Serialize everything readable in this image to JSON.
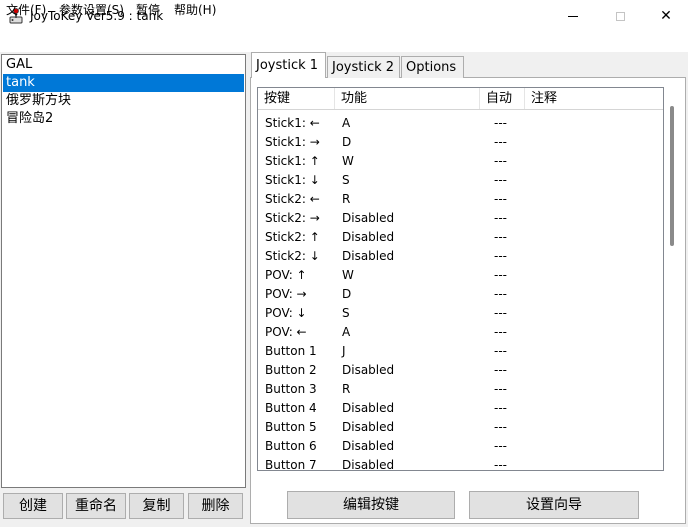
{
  "window": {
    "title": "JoyToKey Ver5.9 : tank",
    "close_glyph": "✕"
  },
  "menu": [
    {
      "label": "文件(F)"
    },
    {
      "label": "参数设置(S)"
    },
    {
      "label": "暂停"
    },
    {
      "label": "帮助(H)"
    }
  ],
  "profiles": [
    {
      "label": "GAL",
      "selected": false
    },
    {
      "label": "tank",
      "selected": true
    },
    {
      "label": "俄罗斯方块",
      "selected": false
    },
    {
      "label": "冒险岛2",
      "selected": false
    }
  ],
  "profile_buttons": {
    "create": "创建",
    "rename": "重命名",
    "copy": "复制",
    "delete": "删除"
  },
  "tabs": [
    {
      "label": "Joystick 1",
      "active": true
    },
    {
      "label": "Joystick 2",
      "active": false
    },
    {
      "label": "Options",
      "active": false
    }
  ],
  "table": {
    "headers": {
      "key": "按键",
      "function": "功能",
      "auto": "自动",
      "note": "注释"
    },
    "rows": [
      {
        "key": "Stick1: ←",
        "function": "A",
        "auto": "---"
      },
      {
        "key": "Stick1: →",
        "function": "D",
        "auto": "---"
      },
      {
        "key": "Stick1: ↑",
        "function": "W",
        "auto": "---"
      },
      {
        "key": "Stick1: ↓",
        "function": "S",
        "auto": "---"
      },
      {
        "key": "Stick2: ←",
        "function": "R",
        "auto": "---"
      },
      {
        "key": "Stick2: →",
        "function": "Disabled",
        "auto": "---"
      },
      {
        "key": "Stick2: ↑",
        "function": "Disabled",
        "auto": "---"
      },
      {
        "key": "Stick2: ↓",
        "function": "Disabled",
        "auto": "---"
      },
      {
        "key": "POV: ↑",
        "function": "W",
        "auto": "---"
      },
      {
        "key": "POV: →",
        "function": "D",
        "auto": "---"
      },
      {
        "key": "POV: ↓",
        "function": "S",
        "auto": "---"
      },
      {
        "key": "POV: ←",
        "function": "A",
        "auto": "---"
      },
      {
        "key": "Button 1",
        "function": "J",
        "auto": "---"
      },
      {
        "key": "Button 2",
        "function": "Disabled",
        "auto": "---"
      },
      {
        "key": "Button 3",
        "function": "R",
        "auto": "---"
      },
      {
        "key": "Button 4",
        "function": "Disabled",
        "auto": "---"
      },
      {
        "key": "Button 5",
        "function": "Disabled",
        "auto": "---"
      },
      {
        "key": "Button 6",
        "function": "Disabled",
        "auto": "---"
      },
      {
        "key": "Button 7",
        "function": "Disabled",
        "auto": "---"
      }
    ]
  },
  "actions": {
    "edit": "编辑按键",
    "wizard": "设置向导"
  }
}
